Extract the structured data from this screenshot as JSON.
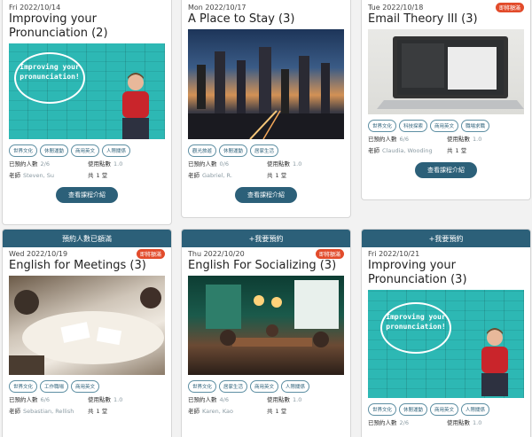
{
  "labels": {
    "booked": "已預約人數",
    "points": "使用點數",
    "teacher": "老師",
    "total": "共",
    "unit": "堂"
  },
  "cards": [
    {
      "date": "Fri 2022/10/14",
      "title": "Improving your Pronunciation (2)",
      "bubble": "Improving your pronunciation!",
      "tags": [
        "世界文化",
        "休閒運動",
        "商用英文",
        "人際關係"
      ],
      "booked": "2/6",
      "points": "1.0",
      "teacher": "Steven, Su",
      "count": "1",
      "button": "查看課程介紹"
    },
    {
      "date": "Mon 2022/10/17",
      "title": "A Place to Stay (3)",
      "tags": [
        "觀光旅遊",
        "休閒運動",
        "居家生活"
      ],
      "booked": "0/6",
      "points": "1.0",
      "teacher": "Gabriel, R.",
      "count": "1",
      "button": "查看課程介紹"
    },
    {
      "date": "Tue 2022/10/18",
      "title": "Email Theory III (3)",
      "badge": "即將額滿",
      "tags": [
        "世界文化",
        "科技探索",
        "商用英文",
        "職場求職"
      ],
      "booked": "6/6",
      "points": "1.0",
      "teacher": "Claudia, Wooding",
      "count": "1",
      "button": "查看課程介紹"
    },
    {
      "topbar": "預約人數已額滿",
      "date": "Wed 2022/10/19",
      "title": "English for Meetings (3)",
      "badge": "即將額滿",
      "tags": [
        "世界文化",
        "工作職場",
        "商用英文"
      ],
      "booked": "6/6",
      "points": "1.0",
      "teacher": "Sebastian, Rellish",
      "count": "1"
    },
    {
      "topbar": "+我要預約",
      "date": "Thu 2022/10/20",
      "title": "English For Socializing (3)",
      "badge": "即將額滿",
      "tags": [
        "世界文化",
        "居家生活",
        "商用英文",
        "人際關係"
      ],
      "booked": "4/6",
      "points": "1.0",
      "teacher": "Karen, Kao",
      "count": "1"
    },
    {
      "topbar": "+我要預約",
      "date": "Fri 2022/10/21",
      "title": "Improving your Pronunciation (3)",
      "bubble": "Improving your pronunciation!",
      "tags": [
        "世界文化",
        "休閒運動",
        "商用英文",
        "人際關係"
      ],
      "booked": "2/6",
      "points": "1.0",
      "teacher": "",
      "count": ""
    }
  ]
}
